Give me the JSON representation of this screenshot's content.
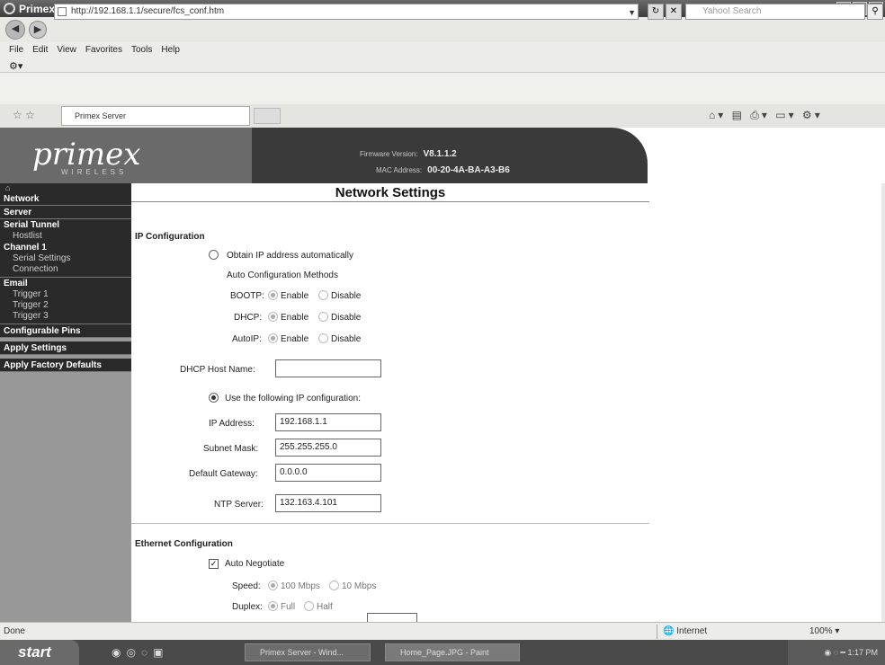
{
  "window": {
    "title": "Primex Server - Windows Internet Explorer"
  },
  "browser": {
    "url": "http://192.168.1.1/secure/fcs_conf.htm",
    "search_placeholder": "Yahoo! Search",
    "menu": [
      "File",
      "Edit",
      "View",
      "Favorites",
      "Tools",
      "Help"
    ],
    "tab_label": "Primex Server"
  },
  "device": {
    "logo": "primex",
    "logo_sub": "WIRELESS",
    "firmware_label": "Firmware Version:",
    "firmware": "V8.1.1.2",
    "mac_label": "MAC Address:",
    "mac": "00-20-4A-BA-A3-B6"
  },
  "sidebar": {
    "items": [
      {
        "label": "Network"
      },
      {
        "label": "Server"
      }
    ],
    "serial_tunnel": {
      "label": "Serial Tunnel",
      "children": [
        "Hostlist"
      ]
    },
    "channel": {
      "label": "Channel 1",
      "children": [
        "Serial Settings",
        "Connection"
      ]
    },
    "email": {
      "label": "Email",
      "children": [
        "Trigger 1",
        "Trigger 2",
        "Trigger 3"
      ]
    },
    "bottom_items": [
      {
        "label": "Configurable Pins"
      },
      {
        "label": "Apply Settings"
      },
      {
        "label": "Apply Factory Defaults"
      }
    ]
  },
  "main": {
    "title": "Network Settings",
    "ip_section": "IP Configuration",
    "obtain_auto": "Obtain IP address automatically",
    "auto_methods": "Auto Configuration Methods",
    "bootp": "BOOTP:",
    "dhcp": "DHCP:",
    "autoip": "AutoIP:",
    "enable": "Enable",
    "disable": "Disable",
    "dhcp_host_name_label": "DHCP Host Name:",
    "dhcp_host_name": "",
    "use_following": "Use the following IP configuration:",
    "ip_address_label": "IP Address:",
    "ip_address": "192.168.1.1",
    "subnet_mask_label": "Subnet Mask:",
    "subnet_mask": "255.255.255.0",
    "gateway_label": "Default Gateway:",
    "gateway": "0.0.0.0",
    "ntp_label": "NTP Server:",
    "ntp": "132.163.4.101",
    "eth_section": "Ethernet Configuration",
    "auto_negotiate": "Auto Negotiate",
    "speed_label": "Speed:",
    "speed_100": "100 Mbps",
    "speed_10": "10 Mbps",
    "duplex_label": "Duplex:",
    "duplex_full": "Full",
    "duplex_half": "Half"
  },
  "status": {
    "text": "Done",
    "zone": "Internet",
    "zoom": "100%"
  },
  "taskbar": {
    "start": "start",
    "tasks": [
      "Primex Server - Wind...",
      "Home_Page.JPG - Paint"
    ],
    "clock": "1:17 PM"
  }
}
